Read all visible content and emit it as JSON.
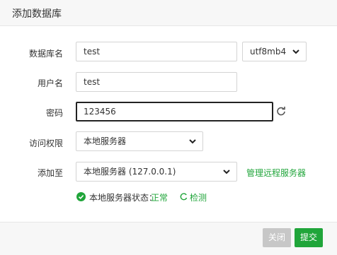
{
  "dialog": {
    "title": "添加数据库"
  },
  "form": {
    "db_name_label": "数据库名",
    "db_name_value": "test",
    "charset_value": "utf8mb4",
    "username_label": "用户名",
    "username_value": "test",
    "password_label": "密码",
    "password_value": "123456",
    "access_label": "访问权限",
    "access_value": "本地服务器",
    "add_to_label": "添加至",
    "add_to_value": "本地服务器 (127.0.0.1)",
    "manage_remote_link": "管理远程服务器"
  },
  "status": {
    "label": "本地服务器状态：",
    "value": "正常",
    "check_label": "检测"
  },
  "footer": {
    "close_label": "关闭",
    "submit_label": "提交"
  },
  "colors": {
    "accent": "#20a53a",
    "disabled": "#c7c7c7"
  }
}
